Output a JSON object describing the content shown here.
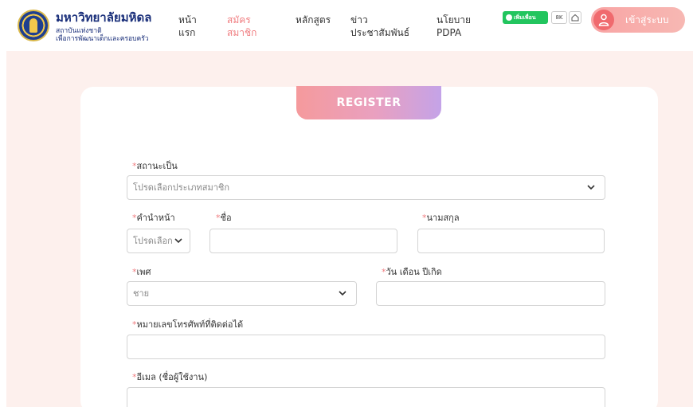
{
  "brand": {
    "title": "มหาวิทยาลัยมหิดล",
    "subtitle_line1": "สถาบันแห่งชาติ",
    "subtitle_line2": "เพื่อการพัฒนาเด็กและครอบครัว"
  },
  "nav": {
    "items": [
      {
        "line1": "หน้า",
        "line2": "แรก"
      },
      {
        "line1": "สมัคร",
        "line2": "สมาชิก",
        "active": true
      },
      {
        "line1": "หลักสูตร",
        "line2": ""
      },
      {
        "line1": "ข่าว",
        "line2": "ประชาสัมพันธ์"
      },
      {
        "line1": "นโยบาย",
        "line2": "PDPA"
      }
    ]
  },
  "header_extras": {
    "line_label": "เพิ่มเพื่อน",
    "count_label": "8K"
  },
  "login": {
    "label": "เข้าสู่ระบบ"
  },
  "form": {
    "title": "REGISTER",
    "status": {
      "label": "สถานะเป็น",
      "placeholder": "โปรดเลือกประเภทสมาชิก"
    },
    "prefix": {
      "label": "คำนำหน้า",
      "placeholder": "โปรดเลือก"
    },
    "first_name": {
      "label": "ชื่อ",
      "value": ""
    },
    "last_name": {
      "label": "นามสกุล",
      "value": ""
    },
    "gender": {
      "label": "เพศ",
      "value": "ชาย"
    },
    "birth_date": {
      "label": "วัน เดือน ปีเกิด",
      "value": ""
    },
    "phone": {
      "label": "หมายเลขโทรศัพท์ที่ติดต่อได้",
      "value": ""
    },
    "email": {
      "label": "อีเมล (ชื่อผู้ใช้งาน)",
      "value": ""
    },
    "required_mark": "*"
  },
  "colors": {
    "accent": "#f07d80",
    "brand_blue": "#1a2f7a",
    "page_background": "#fdf0ed"
  }
}
